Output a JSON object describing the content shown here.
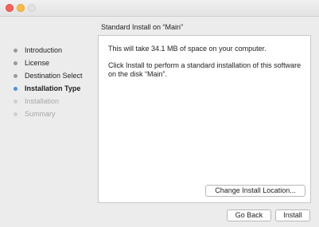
{
  "window": {
    "controls": [
      "close-icon",
      "minimize-icon",
      "zoom-icon"
    ]
  },
  "heading": "Standard Install on “Main”",
  "steps": [
    {
      "label": "Introduction",
      "state": "done"
    },
    {
      "label": "License",
      "state": "done"
    },
    {
      "label": "Destination Select",
      "state": "done"
    },
    {
      "label": "Installation Type",
      "state": "active"
    },
    {
      "label": "Installation",
      "state": "pending"
    },
    {
      "label": "Summary",
      "state": "pending"
    }
  ],
  "content": {
    "space_text": "This will take 34.1 MB of space on your computer.",
    "instruction_text": "Click Install to perform a standard installation of this software on the disk “Main”."
  },
  "buttons": {
    "change_location": "Change Install Location...",
    "go_back": "Go Back",
    "install": "Install"
  },
  "colors": {
    "active_step": "#4a90e2",
    "close": "#fc605c",
    "minimize": "#fdbc40"
  }
}
